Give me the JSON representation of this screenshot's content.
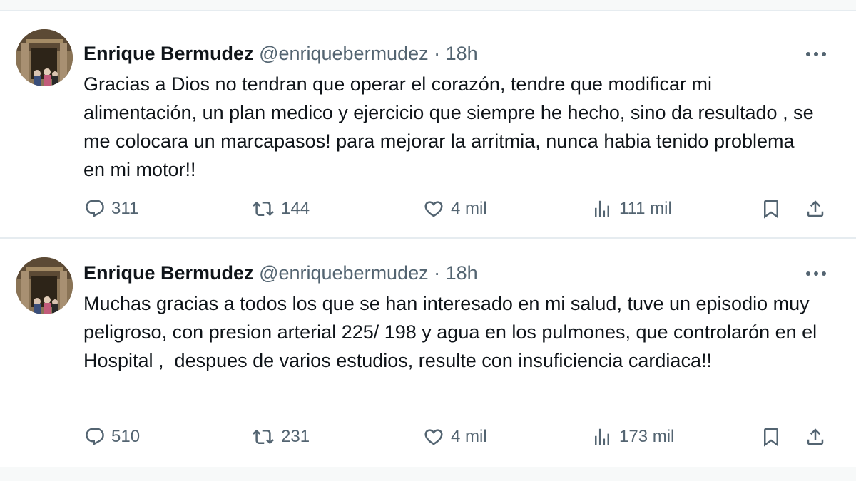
{
  "tweets": [
    {
      "author": "Enrique Bermudez",
      "handle": "@enriquebermudez",
      "sep": "·",
      "time": "18h",
      "text": "Gracias a Dios no tendran que operar el corazón, tendre que modificar mi alimentación, un plan medico y ejercicio que siempre he hecho, sino da resultado , se me colocara un marcapasos! para mejorar la arritmia, nunca habia tenido problema en mi motor!!",
      "replies": "311",
      "retweets": "144",
      "likes": "4 mil",
      "views": "111 mil"
    },
    {
      "author": "Enrique Bermudez",
      "handle": "@enriquebermudez",
      "sep": "·",
      "time": "18h",
      "text": "Muchas gracias a todos los que se han interesado en mi salud, tuve un episodio muy peligroso, con presion arterial 225/ 198 y agua en los pulmones, que controlarón en el Hospital ,  despues de varios estudios, resulte con insuficiencia cardiaca!!",
      "replies": "510",
      "retweets": "231",
      "likes": "4 mil",
      "views": "173 mil"
    }
  ],
  "icons": {
    "more": "more-icon",
    "reply": "reply-icon",
    "retweet": "retweet-icon",
    "like": "like-icon",
    "views": "views-icon",
    "bookmark": "bookmark-icon",
    "share": "share-icon"
  },
  "colors": {
    "text": "#0f1419",
    "muted": "#536471",
    "background": "#ffffff",
    "page": "#f7f9f9"
  }
}
